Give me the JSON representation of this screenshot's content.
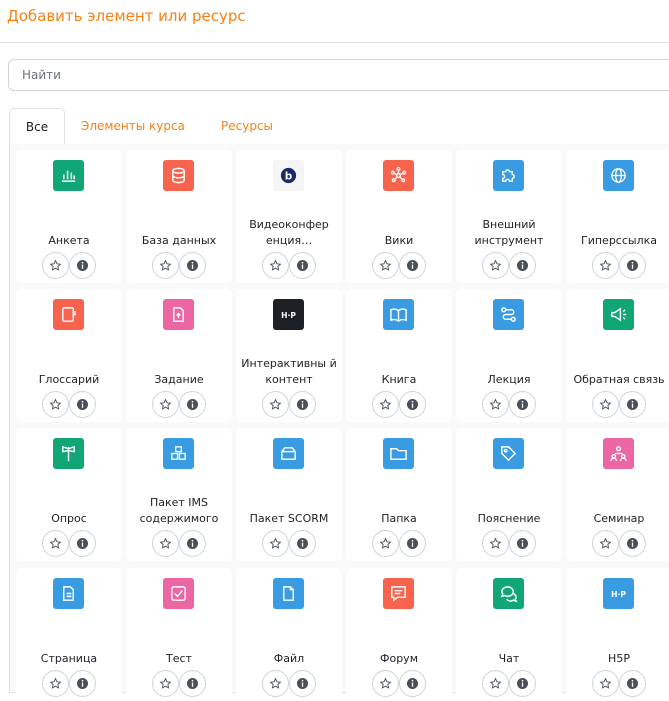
{
  "header": {
    "title": "Добавить элемент или ресурс"
  },
  "search": {
    "placeholder": "Найти"
  },
  "tabs": [
    {
      "label": "Все",
      "active": true
    },
    {
      "label": "Элементы курса",
      "active": false
    },
    {
      "label": "Ресурсы",
      "active": false
    }
  ],
  "modules": [
    {
      "label": "Анкета",
      "icon": "chart-icon",
      "color": "#11a676"
    },
    {
      "label": "База данных",
      "icon": "database-icon",
      "color": "#f7634d"
    },
    {
      "label": "Видеоконфер енция…",
      "icon": "bigbluebutton-icon",
      "color": "#f5f5f5"
    },
    {
      "label": "Вики",
      "icon": "wiki-icon",
      "color": "#f7634d"
    },
    {
      "label": "Внешний инструмент",
      "icon": "puzzle-icon",
      "color": "#399be2"
    },
    {
      "label": "Гиперссылка",
      "icon": "globe-icon",
      "color": "#399be2"
    },
    {
      "label": "Глоссарий",
      "icon": "book-tab-icon",
      "color": "#f7634d"
    },
    {
      "label": "Задание",
      "icon": "upload-doc-icon",
      "color": "#eb66a2"
    },
    {
      "label": "Интерактивны й контент",
      "icon": "h5p-icon",
      "color": "#1d2125"
    },
    {
      "label": "Книга",
      "icon": "book-open-icon",
      "color": "#399be2"
    },
    {
      "label": "Лекция",
      "icon": "path-icon",
      "color": "#399be2"
    },
    {
      "label": "Обратная связь",
      "icon": "megaphone-icon",
      "color": "#11a676"
    },
    {
      "label": "Опрос",
      "icon": "signpost-icon",
      "color": "#11a676"
    },
    {
      "label": "Пакет IMS содержимого",
      "icon": "boxes-icon",
      "color": "#399be2"
    },
    {
      "label": "Пакет SCORM",
      "icon": "package-icon",
      "color": "#399be2"
    },
    {
      "label": "Папка",
      "icon": "folder-icon",
      "color": "#399be2"
    },
    {
      "label": "Пояснение",
      "icon": "tag-icon",
      "color": "#399be2"
    },
    {
      "label": "Семинар",
      "icon": "people-icon",
      "color": "#eb66a2"
    },
    {
      "label": "Страница",
      "icon": "page-icon",
      "color": "#399be2"
    },
    {
      "label": "Тест",
      "icon": "checkbox-icon",
      "color": "#eb66a2"
    },
    {
      "label": "Файл",
      "icon": "file-icon",
      "color": "#399be2"
    },
    {
      "label": "Форум",
      "icon": "forum-icon",
      "color": "#f7634d"
    },
    {
      "label": "Чат",
      "icon": "chat-icon",
      "color": "#11a676"
    },
    {
      "label": "H5P",
      "icon": "h5p-icon",
      "color": "#399be2"
    }
  ],
  "colors": {
    "accent": "#f98012",
    "tab_border": "#dee2e6",
    "panel_bg": "#f8f9fa"
  }
}
